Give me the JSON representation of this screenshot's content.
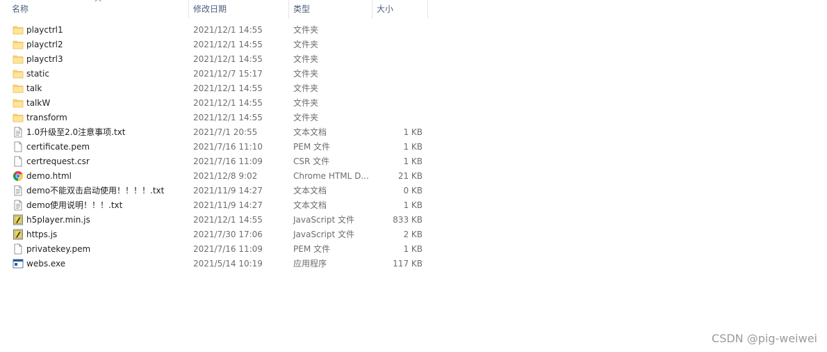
{
  "columns": {
    "name": "名称",
    "date": "修改日期",
    "type": "类型",
    "size": "大小"
  },
  "files": [
    {
      "name": "playctrl1",
      "date": "2021/12/1 14:55",
      "type": "文件夹",
      "size": "",
      "icon": "folder-icon"
    },
    {
      "name": "playctrl2",
      "date": "2021/12/1 14:55",
      "type": "文件夹",
      "size": "",
      "icon": "folder-icon"
    },
    {
      "name": "playctrl3",
      "date": "2021/12/1 14:55",
      "type": "文件夹",
      "size": "",
      "icon": "folder-icon"
    },
    {
      "name": "static",
      "date": "2021/12/7 15:17",
      "type": "文件夹",
      "size": "",
      "icon": "folder-icon"
    },
    {
      "name": "talk",
      "date": "2021/12/1 14:55",
      "type": "文件夹",
      "size": "",
      "icon": "folder-icon"
    },
    {
      "name": "talkW",
      "date": "2021/12/1 14:55",
      "type": "文件夹",
      "size": "",
      "icon": "folder-icon"
    },
    {
      "name": "transform",
      "date": "2021/12/1 14:55",
      "type": "文件夹",
      "size": "",
      "icon": "folder-icon"
    },
    {
      "name": "1.0升级至2.0注意事项.txt",
      "date": "2021/7/1 20:55",
      "type": "文本文档",
      "size": "1 KB",
      "icon": "text-file-icon"
    },
    {
      "name": "certificate.pem",
      "date": "2021/7/16 11:10",
      "type": "PEM 文件",
      "size": "1 KB",
      "icon": "blank-file-icon"
    },
    {
      "name": "certrequest.csr",
      "date": "2021/7/16 11:09",
      "type": "CSR 文件",
      "size": "1 KB",
      "icon": "blank-file-icon"
    },
    {
      "name": "demo.html",
      "date": "2021/12/8 9:02",
      "type": "Chrome HTML D...",
      "size": "21 KB",
      "icon": "chrome-icon"
    },
    {
      "name": "demo不能双击启动使用！！！！.txt",
      "date": "2021/11/9 14:27",
      "type": "文本文档",
      "size": "0 KB",
      "icon": "text-file-icon"
    },
    {
      "name": "demo使用说明！！！.txt",
      "date": "2021/11/9 14:27",
      "type": "文本文档",
      "size": "1 KB",
      "icon": "text-file-icon"
    },
    {
      "name": "h5player.min.js",
      "date": "2021/12/1 14:55",
      "type": "JavaScript 文件",
      "size": "833 KB",
      "icon": "script-file-icon"
    },
    {
      "name": "https.js",
      "date": "2021/7/30 17:06",
      "type": "JavaScript 文件",
      "size": "2 KB",
      "icon": "script-file-icon"
    },
    {
      "name": "privatekey.pem",
      "date": "2021/7/16 11:09",
      "type": "PEM 文件",
      "size": "1 KB",
      "icon": "blank-file-icon"
    },
    {
      "name": "webs.exe",
      "date": "2021/5/14 10:19",
      "type": "应用程序",
      "size": "117 KB",
      "icon": "application-icon"
    }
  ],
  "watermark": "CSDN @pig-weiwei"
}
